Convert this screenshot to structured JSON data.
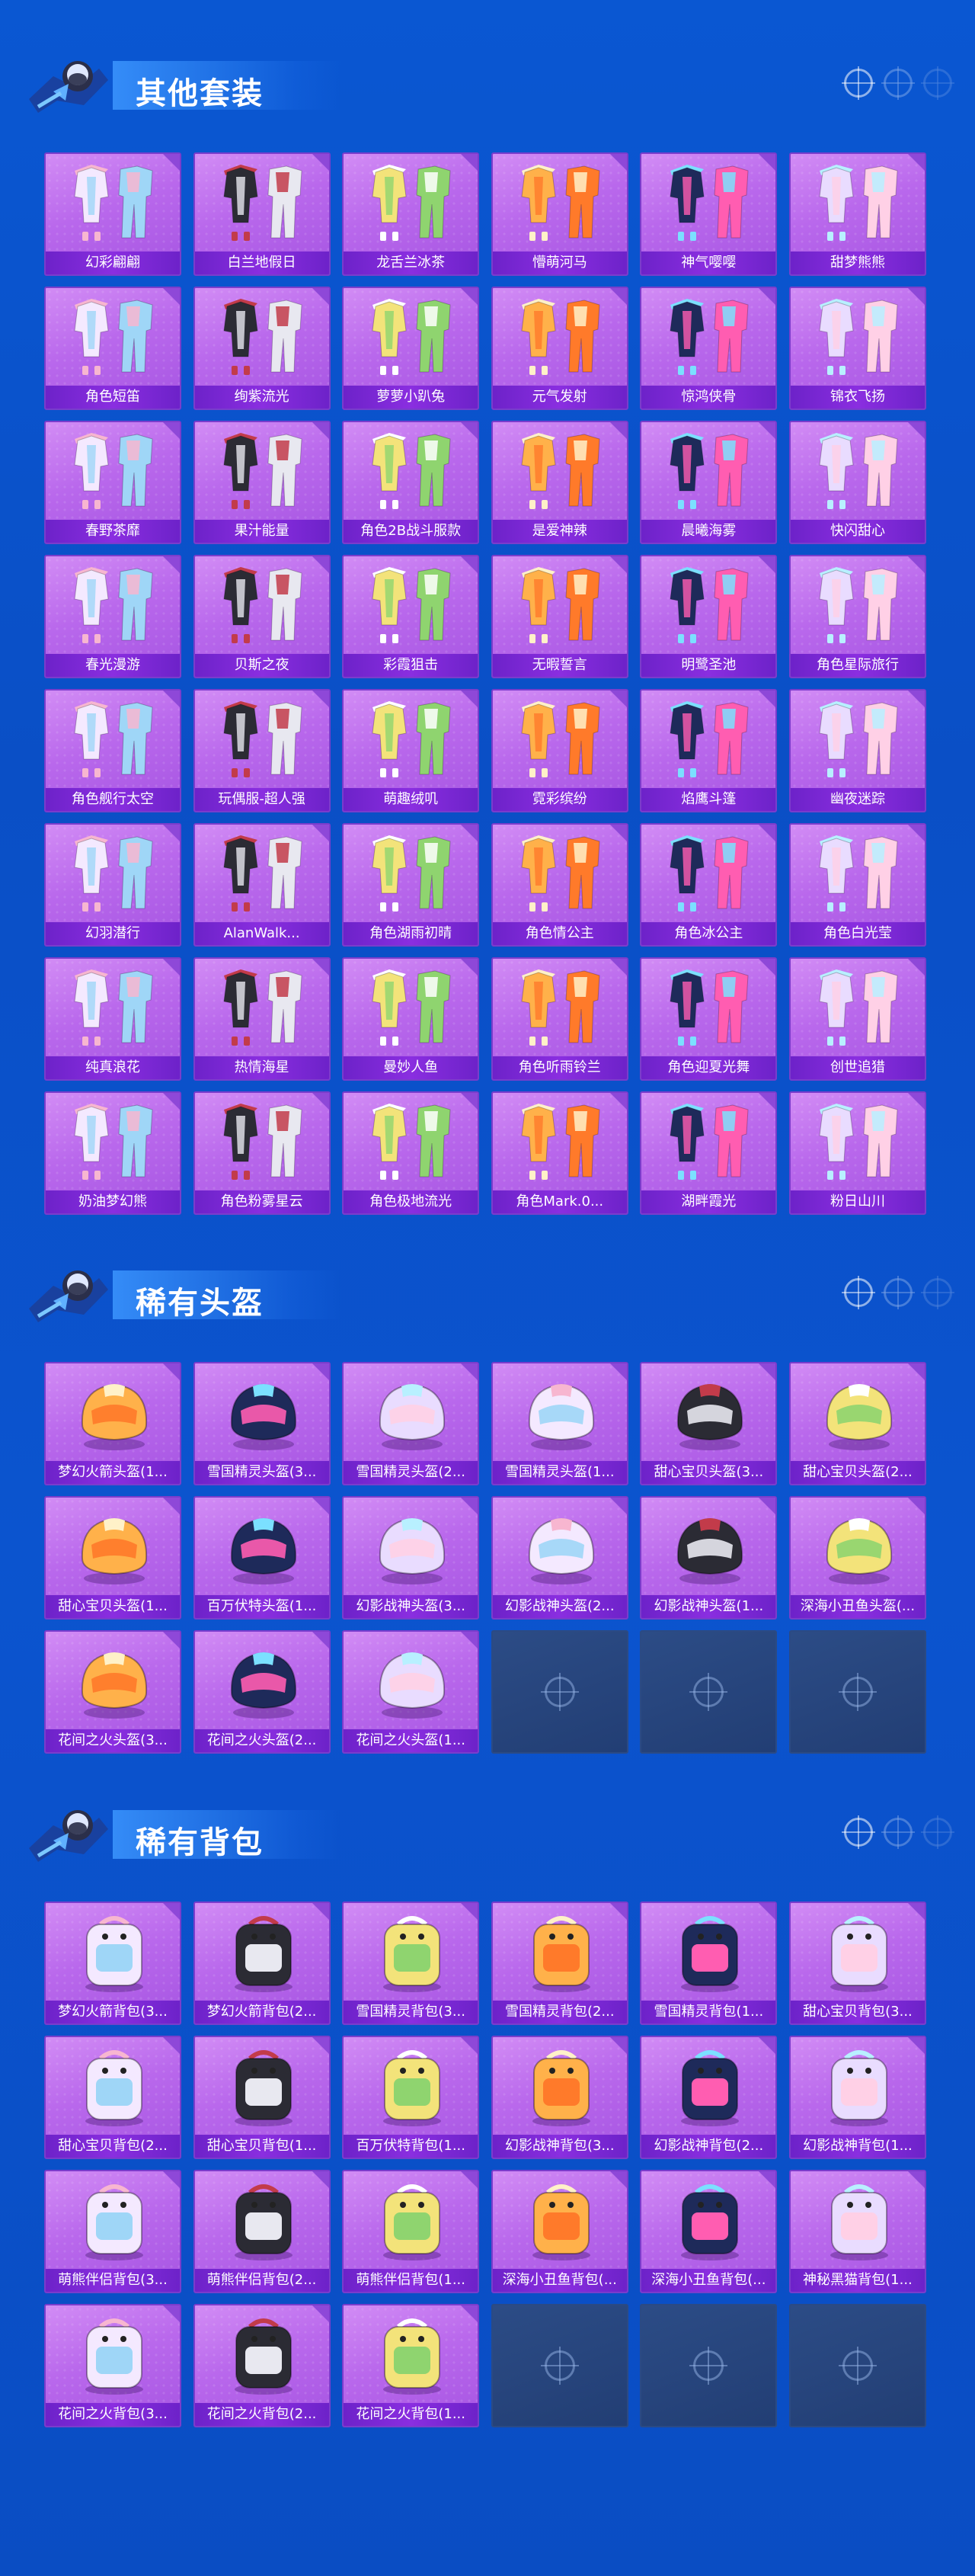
{
  "colors": {
    "background": "#0a52cb",
    "card": "#b968ec",
    "label_bar": "#7b28d6",
    "empty_card": "#264580"
  },
  "sections": [
    {
      "title": "其他套装",
      "item_type": "outfit",
      "items": [
        "幻彩翩翩",
        "白兰地假日",
        "龙舌兰冰茶",
        "懵萌河马",
        "神气嘤嘤",
        "甜梦熊熊",
        "角色短笛",
        "绚紫流光",
        "萝萝小趴兔",
        "元气发射",
        "惊鸿侠骨",
        "锦衣飞扬",
        "春野茶靡",
        "果汁能量",
        "角色2B战斗服款",
        "是爱神辣",
        "晨曦海雾",
        "快闪甜心",
        "春光漫游",
        "贝斯之夜",
        "彩霞狙击",
        "无暇誓言",
        "明鹭圣池",
        "角色星际旅行",
        "角色舰行太空",
        "玩偶服-超人强",
        "萌趣绒叽",
        "霓彩缤纷",
        "焰鹰斗篷",
        "幽夜迷踪",
        "幻羽潜行",
        "AlanWalk...",
        "角色湖雨初晴",
        "角色情公主",
        "角色冰公主",
        "角色白光莹",
        "纯真浪花",
        "热情海星",
        "曼妙人鱼",
        "角色听雨铃兰",
        "角色迎夏光舞",
        "创世追猎",
        "奶油梦幻熊",
        "角色粉雾星云",
        "角色极地流光",
        "角色Mark.0...",
        "湖畔霞光",
        "粉日山川"
      ],
      "empty_slots": 0
    },
    {
      "title": "稀有头盔",
      "item_type": "helmet",
      "items": [
        "梦幻火箭头盔(1...",
        "雪国精灵头盔(3...",
        "雪国精灵头盔(2...",
        "雪国精灵头盔(1...",
        "甜心宝贝头盔(3...",
        "甜心宝贝头盔(2...",
        "甜心宝贝头盔(1...",
        "百万伏特头盔(1...",
        "幻影战神头盔(3...",
        "幻影战神头盔(2...",
        "幻影战神头盔(1...",
        "深海小丑鱼头盔(...",
        "花间之火头盔(3...",
        "花间之火头盔(2...",
        "花间之火头盔(1..."
      ],
      "empty_slots": 3
    },
    {
      "title": "稀有背包",
      "item_type": "backpack",
      "items": [
        "梦幻火箭背包(3...",
        "梦幻火箭背包(2...",
        "雪国精灵背包(3...",
        "雪国精灵背包(2...",
        "雪国精灵背包(1...",
        "甜心宝贝背包(3...",
        "甜心宝贝背包(2...",
        "甜心宝贝背包(1...",
        "百万伏特背包(1...",
        "幻影战神背包(3...",
        "幻影战神背包(2...",
        "幻影战神背包(1...",
        "萌熊伴侣背包(3...",
        "萌熊伴侣背包(2...",
        "萌熊伴侣背包(1...",
        "深海小丑鱼背包(...",
        "深海小丑鱼背包(...",
        "神秘黑猫背包(1...",
        "花间之火背包(3...",
        "花间之火背包(2...",
        "花间之火背包(1..."
      ],
      "empty_slots": 3
    }
  ]
}
